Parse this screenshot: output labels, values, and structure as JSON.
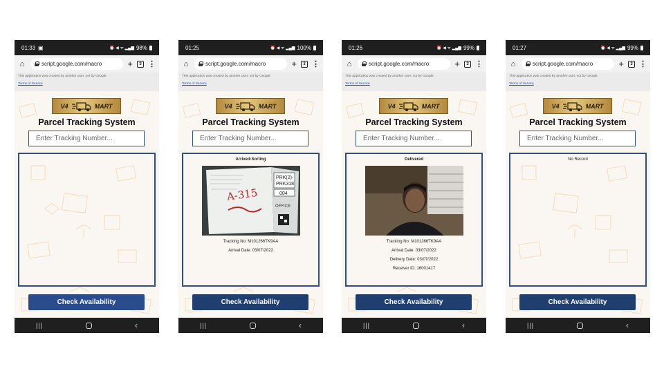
{
  "app": {
    "url": "script.google.com/macro",
    "notice": "This application was created by another user, not by Google.",
    "terms": "Terms of Service",
    "logo_left": "V4",
    "logo_right": "MART",
    "title": "Parcel Tracking System",
    "search_placeholder": "Enter Tracking Number...",
    "button": "Check Availability"
  },
  "icons": {
    "home": "home-icon",
    "lock": "lock-icon",
    "new_tab": "plus-icon",
    "tabs": "tabs-icon",
    "menu": "more-vert-icon",
    "nav_recent": "recent-apps-icon",
    "nav_home": "nav-home-icon",
    "nav_back": "back-icon",
    "truck": "truck-icon"
  },
  "colors": {
    "button": "#213e70",
    "button_first": "#2b4c8c",
    "box_border": "#2c4f8c",
    "logo_gold": "#d3b064"
  },
  "phones": [
    {
      "time": "01:33",
      "extra_status": "▣",
      "battery": "98%",
      "status": "",
      "info": []
    },
    {
      "time": "01:25",
      "extra_status": "",
      "battery": "100%",
      "status": "Arrived-Sorting",
      "info": [
        "Tracking No: M101266TK9AA",
        "Arrival Date: 03/07/2022"
      ]
    },
    {
      "time": "01:26",
      "extra_status": "",
      "battery": "99%",
      "status": "Delivered",
      "info": [
        "Tracking No: M101266TK9AA",
        "Arrival Date: 03/07/2022",
        "Delivery Date: 03/07/2022",
        "Receiver ID: 16001417"
      ]
    },
    {
      "time": "01:27",
      "extra_status": "",
      "battery": "99%",
      "status": "No Record",
      "info": []
    }
  ],
  "photo_label": {
    "line1": "PRK(2)-",
    "line2": "PRK318",
    "code": "004",
    "handwritten": "A-315",
    "small": "OFFICE"
  },
  "status_glyphs": "⏰ ◀ ᯤ ▂▄▆"
}
